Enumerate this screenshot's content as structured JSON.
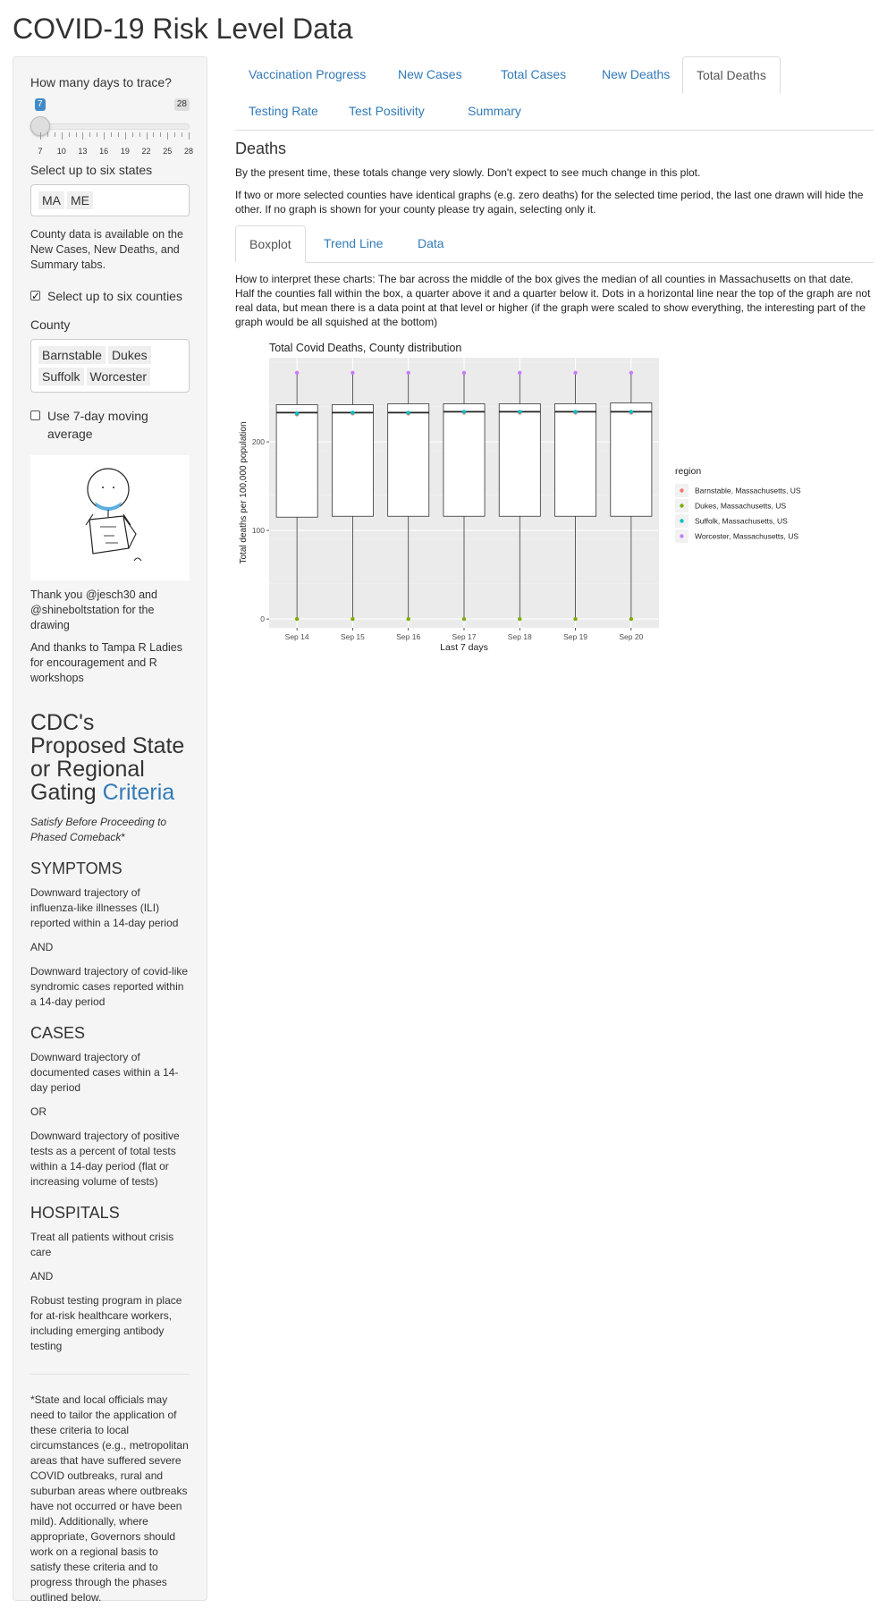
{
  "app_title": "COVID-19 Risk Level Data",
  "sidebar": {
    "days_label": "How many days to trace?",
    "slider": {
      "min": 7,
      "max": 28,
      "value": 7,
      "min_badge": "7",
      "max_badge": "28",
      "tick_labels": [
        "7",
        "10",
        "13",
        "16",
        "19",
        "22",
        "25",
        "28"
      ]
    },
    "states_label": "Select up to six states",
    "states": [
      "MA",
      "ME"
    ],
    "county_help": "County data is available on the New Cases, New Deaths, and Summary tabs.",
    "counties_checkbox": {
      "label": "Select up to six counties",
      "checked": true
    },
    "county_label": "County",
    "counties": [
      "Barnstable",
      "Dukes",
      "Suffolk",
      "Worcester"
    ],
    "moving_avg_checkbox": {
      "label": "Use 7-day moving average",
      "checked": false
    },
    "thanks1": "Thank you @jesch30 and @shineboltstation for the drawing",
    "thanks2": "And thanks to Tampa R Ladies for encouragement and R workshops",
    "cdc_title": "CDC's Proposed State or Regional Gating",
    "cdc_link": "Criteria",
    "cdc_sub_main": "Satisfy Before Proceeding to Phased Comeback",
    "cdc_sub_star": "*",
    "symptoms_h": "SYMPTOMS",
    "symptoms_1": "Downward trajectory of influenza-like illnesses (ILI) reported within a 14-day period",
    "and1": "AND",
    "symptoms_2": "Downward trajectory of covid-like syndromic cases reported within a 14-day period",
    "cases_h": "CASES",
    "cases_1": "Downward trajectory of documented cases within a 14-day period",
    "or1": "OR",
    "cases_2": "Downward trajectory of positive tests as a percent of total tests within a 14-day period (flat or increasing volume of tests)",
    "hospitals_h": "HOSPITALS",
    "hosp_1": "Treat all patients without crisis care",
    "and2": "AND",
    "hosp_2": "Robust testing program in place for at-risk healthcare workers, including emerging antibody testing",
    "footnote": "*State and local officials may need to tailor the application of these criteria to local circumstances (e.g., metropolitan areas that have suffered severe COVID outbreaks, rural and suburban areas where outbreaks have not occurred or have been mild). Additionally, where appropriate, Governors should work on a regional basis to satisfy these criteria and to progress through the phases outlined below."
  },
  "tabs": [
    "Vaccination Progress",
    "New Cases",
    "Total Cases",
    "New Deaths",
    "Total Deaths",
    "Testing Rate",
    "Test Positivity",
    "Summary"
  ],
  "active_tab": "Total Deaths",
  "content": {
    "heading": "Deaths",
    "p1": "By the present time, these totals change very slowly. Don't expect to see much change in this plot.",
    "p2": "If two or more selected counties have identical graphs (e.g. zero deaths) for the selected time period, the last one drawn will hide the other. If no graph is shown for your county please try again, selecting only it.",
    "subtabs": [
      "Boxplot",
      "Trend Line",
      "Data"
    ],
    "active_subtab": "Boxplot",
    "interpret": "How to interpret these charts: The bar across the middle of the box gives the median of all counties in Massachusetts on that date. Half the counties fall within the box, a quarter above it and a quarter below it. Dots in a horizontal line near the top of the graph are not real data, but mean there is a data point at that level or higher (if the graph were scaled to show everything, the interesting part of the graph would be all squished at the bottom)"
  },
  "chart_data": {
    "type": "boxplot",
    "title": "Total Covid Deaths, County distribution",
    "xlabel": "Last 7 days",
    "ylabel": "Total deaths per 100,000 population",
    "ylim": [
      -10,
      295
    ],
    "yticks": [
      0,
      100,
      200
    ],
    "categories": [
      "Sep 14",
      "Sep 15",
      "Sep 16",
      "Sep 17",
      "Sep 18",
      "Sep 19",
      "Sep 20"
    ],
    "boxes": [
      {
        "q1": 115,
        "median": 233,
        "q3": 242,
        "min": 0,
        "max": 278
      },
      {
        "q1": 116,
        "median": 233,
        "q3": 242,
        "min": 0,
        "max": 278
      },
      {
        "q1": 116,
        "median": 233,
        "q3": 243,
        "min": 0,
        "max": 278
      },
      {
        "q1": 116,
        "median": 234,
        "q3": 243,
        "min": 0,
        "max": 278
      },
      {
        "q1": 116,
        "median": 234,
        "q3": 243,
        "min": 0,
        "max": 278
      },
      {
        "q1": 116,
        "median": 234,
        "q3": 243,
        "min": 0,
        "max": 278
      },
      {
        "q1": 116,
        "median": 234,
        "q3": 244,
        "min": 0,
        "max": 278
      }
    ],
    "legend_title": "region",
    "legend_position": "right",
    "grid": true,
    "series": [
      {
        "name": "Barnstable, Massachusetts, US",
        "color": "#f8766d",
        "values": [
          231,
          232,
          232,
          233,
          233,
          233,
          233
        ]
      },
      {
        "name": "Dukes, Massachusetts, US",
        "color": "#7cae00",
        "values": [
          0,
          0,
          0,
          0,
          0,
          0,
          0
        ]
      },
      {
        "name": "Suffolk, Massachusetts, US",
        "color": "#00bfc4",
        "values": [
          232,
          233,
          233,
          234,
          234,
          234,
          234
        ]
      },
      {
        "name": "Worcester, Massachusetts, US",
        "color": "#c77cff",
        "values": [
          278,
          278,
          278,
          278,
          278,
          278,
          278
        ]
      }
    ]
  }
}
